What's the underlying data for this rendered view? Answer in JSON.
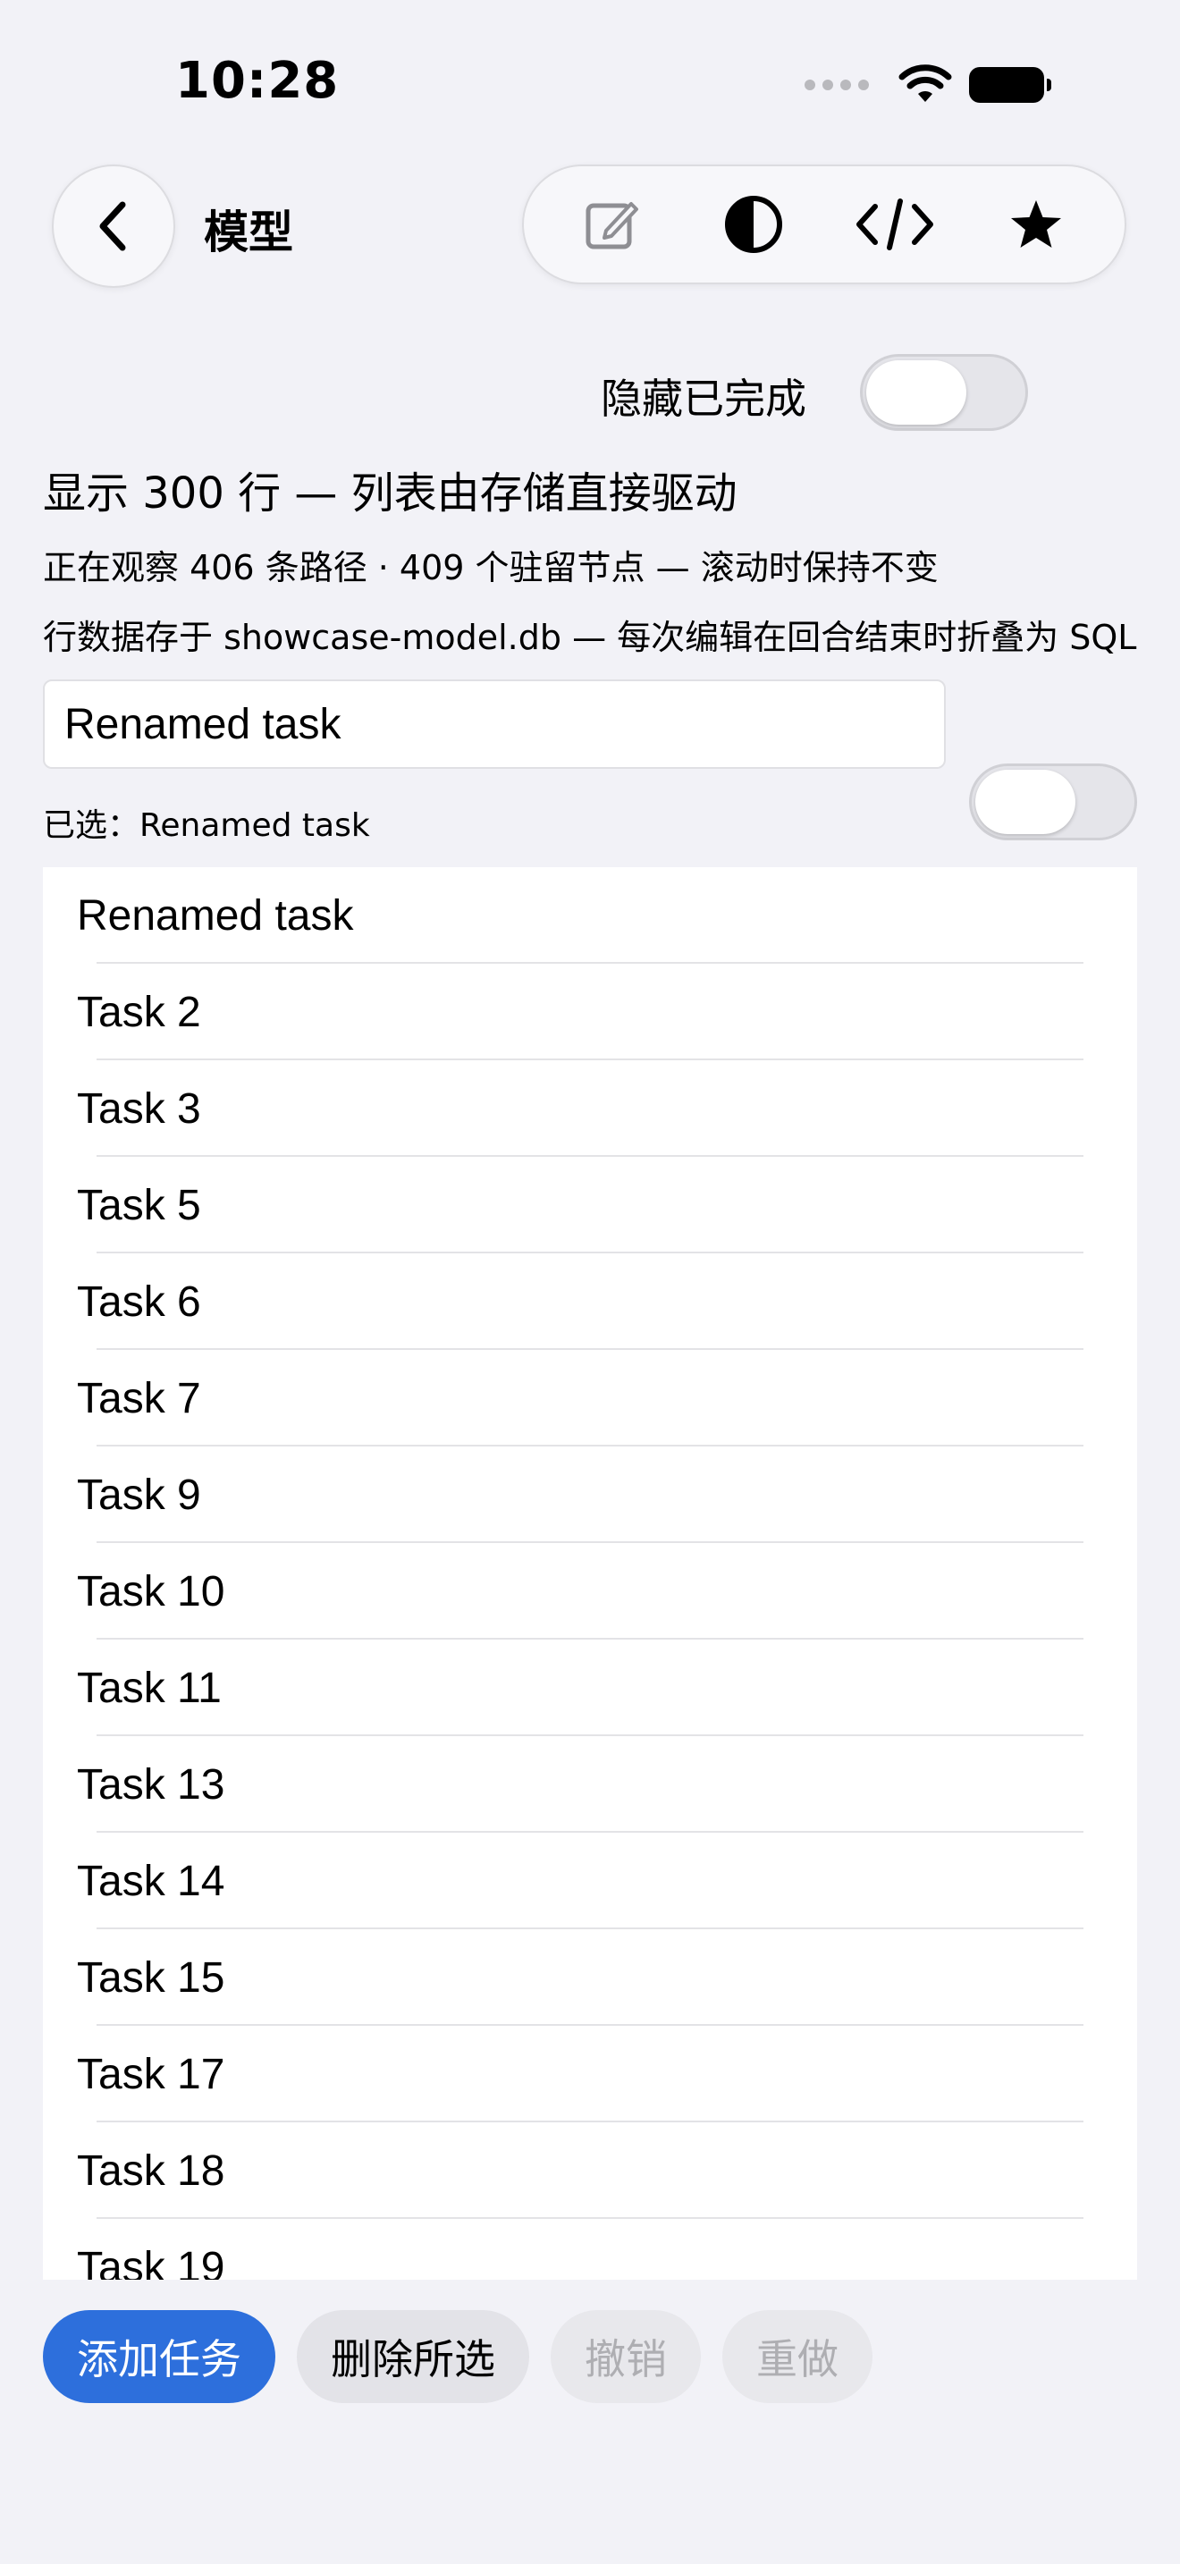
{
  "status": {
    "time": "10:28"
  },
  "nav": {
    "title": "模型",
    "toolbar_icons": [
      "compose-icon",
      "contrast-icon",
      "code-icon",
      "star-icon"
    ]
  },
  "filter": {
    "hide_completed_label": "隐藏已完成",
    "hide_completed_on": false
  },
  "summary": {
    "headline": "显示 300 行 — 列表由存储直接驱动",
    "observing": "正在观察 406 条路径 · 409 个驻留节点 — 滚动时保持不变",
    "storage": "行数据存于 showcase-model.db — 每次编辑在回合结束时折叠为 SQL"
  },
  "editor": {
    "value": "Renamed task",
    "done_on": false,
    "selected_label": "已选：Renamed task"
  },
  "tasks": [
    "Renamed task",
    "Task 2",
    "Task 3",
    "Task 5",
    "Task 6",
    "Task 7",
    "Task 9",
    "Task 10",
    "Task 11",
    "Task 13",
    "Task 14",
    "Task 15",
    "Task 17",
    "Task 18",
    "Task 19"
  ],
  "actions": {
    "add": "添加任务",
    "delete": "删除所选",
    "undo": "撤销",
    "redo": "重做"
  },
  "colors": {
    "accent": "#2d6fdc",
    "background": "#f2f2f7"
  }
}
